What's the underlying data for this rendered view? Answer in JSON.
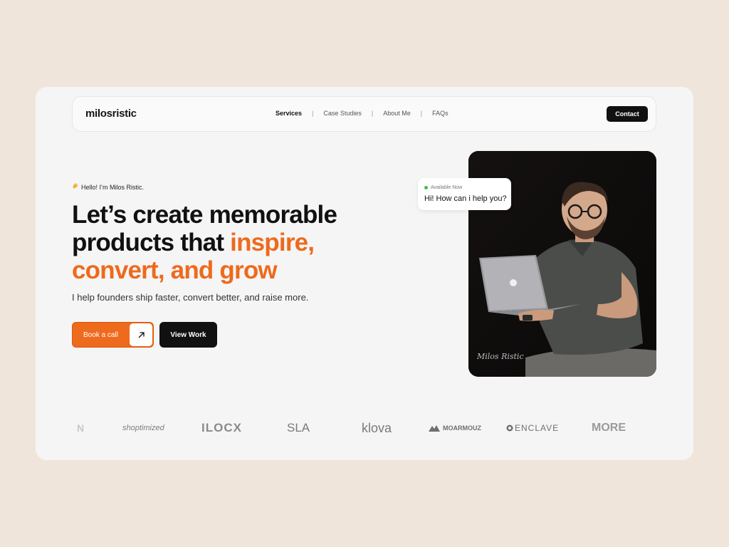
{
  "nav": {
    "logo": "milosristic",
    "links": [
      {
        "label": "Services"
      },
      {
        "label": "Case Studies"
      },
      {
        "label": "About Me"
      },
      {
        "label": "FAQs"
      }
    ],
    "separator": "|",
    "contact": "Contact"
  },
  "hero": {
    "greeting": "Hello! I’m Milos Ristic.",
    "greeting_icon": "waving-hand-icon",
    "headline_line1": "Let’s create memorable",
    "headline_line2_plain": "products that ",
    "headline_line2_accent": "inspire,",
    "headline_line3_accent": "convert, and grow",
    "subtitle": "I help founders ship faster, convert better, and raise more.",
    "book_call": "Book a call",
    "view_work": "View Work"
  },
  "chat": {
    "status": "Available Now",
    "message": "Hi! How can i help you?"
  },
  "photo": {
    "signature": "Milos Ristic"
  },
  "brands": [
    "N",
    "shoptimized",
    "ILOCX",
    "SLA",
    "klova",
    "MOARMOUZ",
    "ENCLAVE",
    "MORE"
  ],
  "colors": {
    "accent": "#ee6a1c",
    "dark": "#111111",
    "background": "#efe5db",
    "card": "#f5f5f5",
    "status_green": "#3ec24a"
  }
}
